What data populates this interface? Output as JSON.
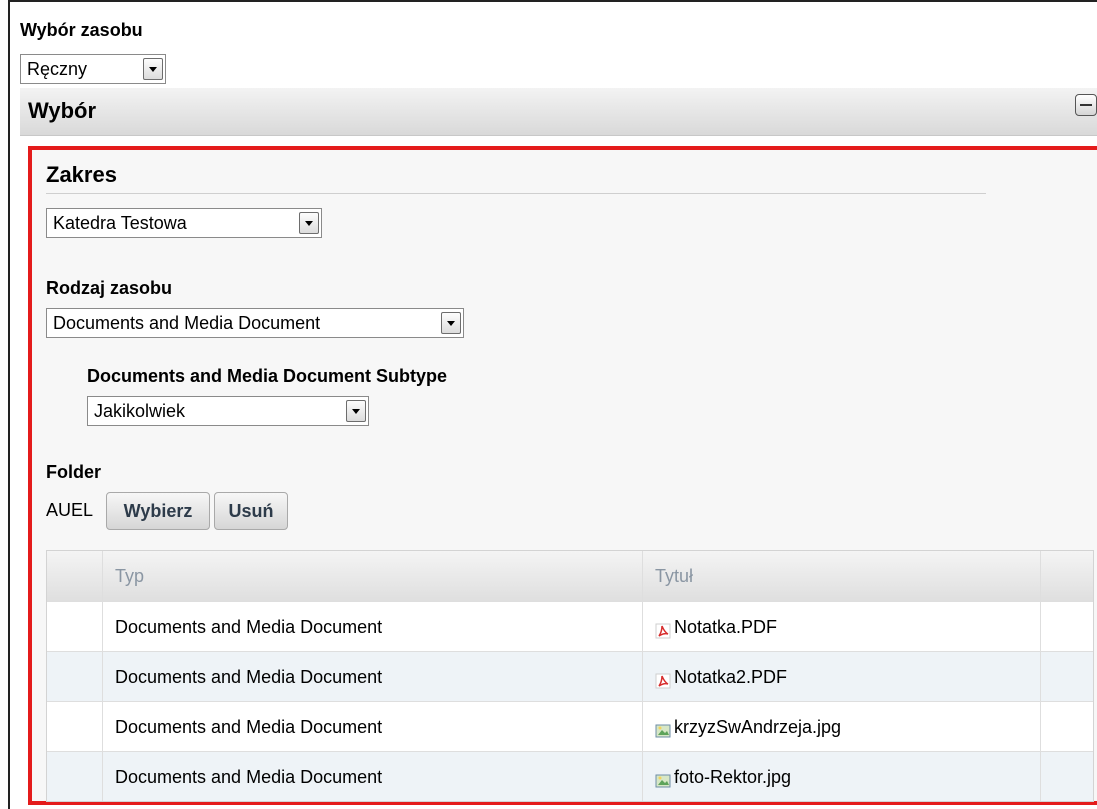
{
  "top": {
    "title": "Wybór zasobu",
    "mode_select": "Ręczny"
  },
  "panel": {
    "title": "Wybór"
  },
  "scope": {
    "title": "Zakres",
    "site_select": "Katedra Testowa"
  },
  "asset_type": {
    "label": "Rodzaj zasobu",
    "select": "Documents and Media Document",
    "subtype_label": "Documents and Media Document Subtype",
    "subtype_select": "Jakikolwiek"
  },
  "folder": {
    "label": "Folder",
    "value": "AUEL",
    "select_button": "Wybierz",
    "remove_button": "Usuń"
  },
  "table": {
    "headers": [
      "",
      "Typ",
      "Tytuł",
      ""
    ],
    "rows": [
      {
        "type": "Documents and Media Document",
        "title": "Notatka.PDF",
        "icon": "pdf-icon"
      },
      {
        "type": "Documents and Media Document",
        "title": "Notatka2.PDF",
        "icon": "pdf-icon"
      },
      {
        "type": "Documents and Media Document",
        "title": "krzyzSwAndrzeja.jpg",
        "icon": "image-icon"
      },
      {
        "type": "Documents and Media Document",
        "title": "foto-Rektor.jpg",
        "icon": "image-icon"
      }
    ]
  },
  "colors": {
    "highlight_border": "#e41b1b",
    "alt_row": "#eef3f7"
  }
}
